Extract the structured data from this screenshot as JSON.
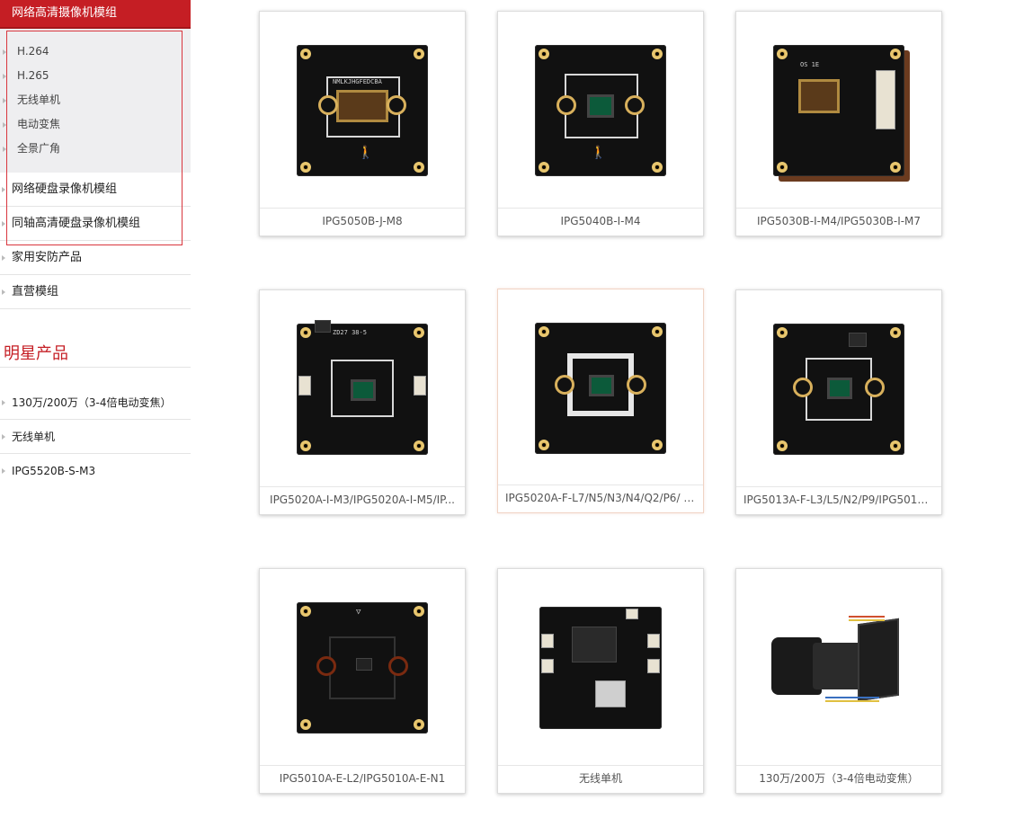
{
  "sidebar": {
    "active_category": "网络高清摄像机模组",
    "sub_items": [
      "H.264",
      "H.265",
      "无线单机",
      "电动变焦",
      "全景广角"
    ],
    "categories": [
      "网络硬盘录像机模组",
      "同轴高清硬盘录像机模组",
      "家用安防产品",
      "直营模组"
    ],
    "star_title": "明星产品",
    "star_items": [
      "130万/200万（3-4倍电动变焦）",
      "无线单机",
      "IPG5520B-S-M3"
    ]
  },
  "products": [
    {
      "caption": "IPG5050B-J-M8",
      "image": "pcb-board"
    },
    {
      "caption": "IPG5040B-I-M4",
      "image": "pcb-board"
    },
    {
      "caption": "IPG5030B-I-M4/IPG5030B-I-M7",
      "image": "pcb-module-stack"
    },
    {
      "caption": "IPG5020A-I-M3/IPG5020A-I-M5/IP...",
      "image": "pcb-board"
    },
    {
      "caption": "IPG5020A-F-L7/N5/N3/N4/Q2/P6/ I...",
      "image": "pcb-board"
    },
    {
      "caption": "IPG5013A-F-L3/L5/N2/P9/IPG5013...",
      "image": "pcb-board"
    },
    {
      "caption": "IPG5010A-E-L2/IPG5010A-E-N1",
      "image": "pcb-board"
    },
    {
      "caption": "无线单机",
      "image": "wireless-board"
    },
    {
      "caption": "130万/200万（3-4倍电动变焦）",
      "image": "zoom-lens-module"
    }
  ],
  "colors": {
    "accent": "#c51e24",
    "sidebar_bg": "#eeeef0",
    "highlight_border": "#d9363e"
  }
}
